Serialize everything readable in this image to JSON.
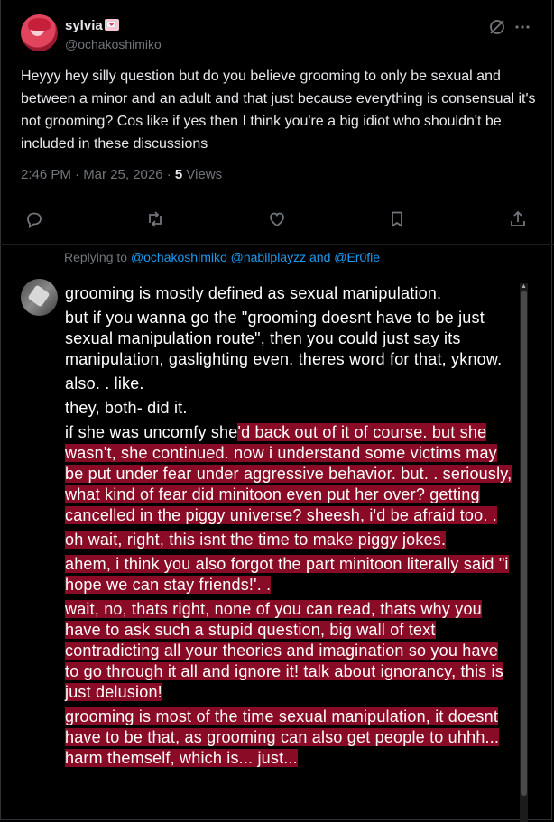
{
  "tweet": {
    "author_name": "sylvia",
    "author_badge": "💌",
    "author_handle": "@ochakoshimiko",
    "text": "Heyyy hey silly question but do you believe grooming to only be sexual and between a minor and an adult and that just because everything is consensual it's not grooming? Cos like if yes then I think you're a big idiot who shouldn't be included in these discussions",
    "time": "2:46 PM · Mar 25, 2026 · ",
    "views_count": "5",
    "views_label": " Views"
  },
  "icons": {
    "grok": "grok-slash-icon",
    "more": "more-icon",
    "reply": "reply-icon",
    "retweet": "retweet-icon",
    "like": "heart-icon",
    "bookmark": "bookmark-icon",
    "share": "share-icon"
  },
  "reply": {
    "replying_prefix": "Replying to ",
    "replying_mentions": "@ochakoshimiko @nabilplayzz",
    "replying_and": " and ",
    "replying_last": "@Er0fie",
    "paragraphs": [
      "grooming is mostly defined as sexual manipulation.",
      "but if you wanna go the \"grooming doesnt have to be just sexual manipulation route\", then you could just say its manipulation, gaslighting even. theres word for that, yknow.",
      "also. . like.",
      "they, both- did it.",
      "if she was uncomfy she",
      "'d back out of it of course. but she wasn't, she continued. now i understand some victims may be put under fear under aggressive behavior. but. . seriously, what kind of fear did minitoon even put her over? getting cancelled in the piggy universe? sheesh, i'd be afraid too. .",
      "oh wait, right, this isnt the time to make piggy jokes.",
      "ahem, i think you also forgot the part minitoon literally said \"i hope we can stay friends!'. .",
      "wait, no, thats right, none of you can read, thats why you have to ask such a stupid question, big wall of text contradicting all your theories and imagination so you have to go through it all and ignore it! talk about ignorancy, this is just delusion!",
      "grooming is most of the time sexual manipulation, it doesnt have to be that, as grooming can also get people to uhhh... harm themself, which is... just..."
    ]
  },
  "colors": {
    "background": "#000000",
    "highlight": "#8a0b25",
    "mention": "#1d9bf0",
    "muted": "#71767b"
  }
}
